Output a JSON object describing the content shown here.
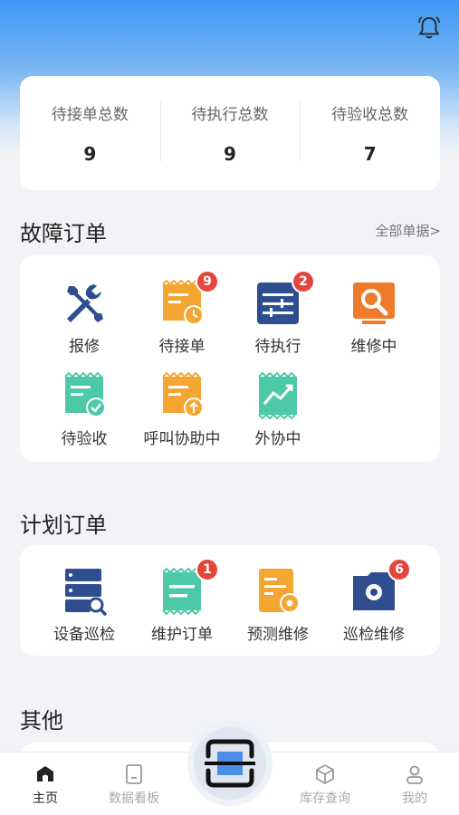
{
  "stats": [
    {
      "label": "待接单总数",
      "value": "9"
    },
    {
      "label": "待执行总数",
      "value": "9"
    },
    {
      "label": "待验收总数",
      "value": "7"
    }
  ],
  "fault_orders": {
    "title": "故障订单",
    "link": "全部单据>",
    "items": [
      {
        "label": "报修",
        "icon": "tools-icon"
      },
      {
        "label": "待接单",
        "icon": "pending-order-icon",
        "badge": "9"
      },
      {
        "label": "待执行",
        "icon": "pending-execute-icon",
        "badge": "2"
      },
      {
        "label": "维修中",
        "icon": "repairing-icon"
      },
      {
        "label": "待验收",
        "icon": "pending-accept-icon"
      },
      {
        "label": "呼叫协助中",
        "icon": "call-assist-icon"
      },
      {
        "label": "外协中",
        "icon": "outsourcing-icon"
      }
    ]
  },
  "plan_orders": {
    "title": "计划订单",
    "items": [
      {
        "label": "设备巡检",
        "icon": "device-inspection-icon"
      },
      {
        "label": "维护订单",
        "icon": "maintenance-order-icon",
        "badge": "1"
      },
      {
        "label": "预测维修",
        "icon": "predictive-repair-icon"
      },
      {
        "label": "巡检维修",
        "icon": "inspection-repair-icon",
        "badge": "6"
      }
    ]
  },
  "other": {
    "title": "其他"
  },
  "nav": [
    {
      "label": "主页",
      "icon": "home-icon",
      "active": true
    },
    {
      "label": "数据看板",
      "icon": "dashboard-icon"
    },
    {
      "label": "库存查询",
      "icon": "inventory-icon"
    },
    {
      "label": "我的",
      "icon": "profile-icon"
    }
  ],
  "colors": {
    "blue": "#2f4e8f",
    "orange": "#f4a633",
    "teal": "#4ec9a8",
    "badge": "#e5463c"
  }
}
